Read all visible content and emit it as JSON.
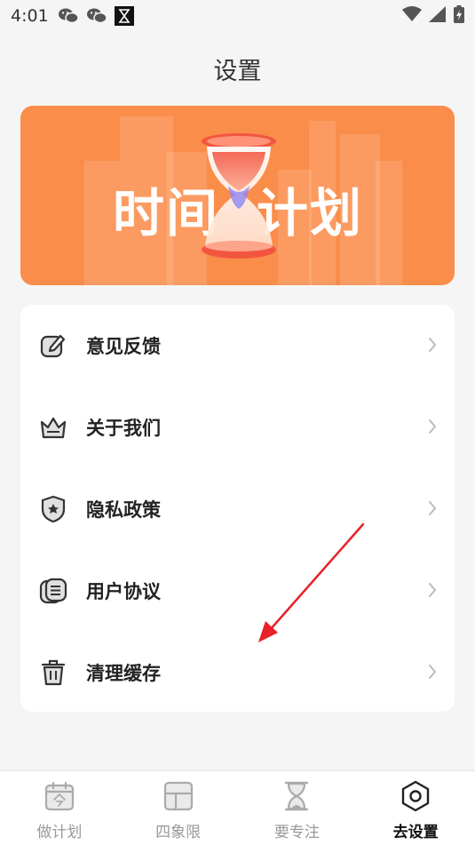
{
  "status_bar": {
    "time": "4:01",
    "icons": [
      "wechat-icon",
      "wechat-icon",
      "hourglass-app-icon",
      "wifi-icon",
      "signal-icon",
      "battery-icon"
    ]
  },
  "page": {
    "title": "设置"
  },
  "banner": {
    "text_left": "时间",
    "text_right": "计划",
    "background_color": "#fb8d4a"
  },
  "menu": {
    "items": [
      {
        "label": "意见反馈",
        "icon": "feedback-icon"
      },
      {
        "label": "关于我们",
        "icon": "crown-icon"
      },
      {
        "label": "隐私政策",
        "icon": "shield-icon"
      },
      {
        "label": "用户协议",
        "icon": "document-icon"
      },
      {
        "label": "清理缓存",
        "icon": "trash-icon"
      }
    ]
  },
  "bottom_nav": {
    "tabs": [
      {
        "label": "做计划",
        "icon": "calendar-icon",
        "active": false
      },
      {
        "label": "四象限",
        "icon": "quadrant-icon",
        "active": false
      },
      {
        "label": "要专注",
        "icon": "hourglass-icon",
        "active": false
      },
      {
        "label": "去设置",
        "icon": "settings-icon",
        "active": true
      }
    ]
  },
  "colors": {
    "accent": "#fb8d4a",
    "annotation_arrow": "#e8202a"
  }
}
